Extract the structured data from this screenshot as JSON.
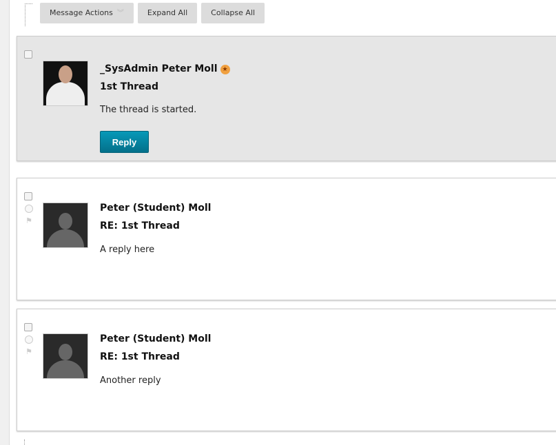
{
  "toolbar": {
    "message_actions": "Message Actions",
    "expand_all": "Expand All",
    "collapse_all": "Collapse All"
  },
  "posts": [
    {
      "author": "_SysAdmin Peter Moll",
      "subject": "1st Thread",
      "body": "The thread is started.",
      "reply_label": "Reply",
      "badge_icon": "star-badge-icon"
    },
    {
      "author": "Peter (Student) Moll",
      "subject": "RE: 1st Thread",
      "body": "A reply here"
    },
    {
      "author": "Peter (Student) Moll",
      "subject": "RE: 1st Thread",
      "body": "Another reply"
    }
  ],
  "colors": {
    "reply_button": "#05849f",
    "highlight": "#e6e6e6"
  }
}
